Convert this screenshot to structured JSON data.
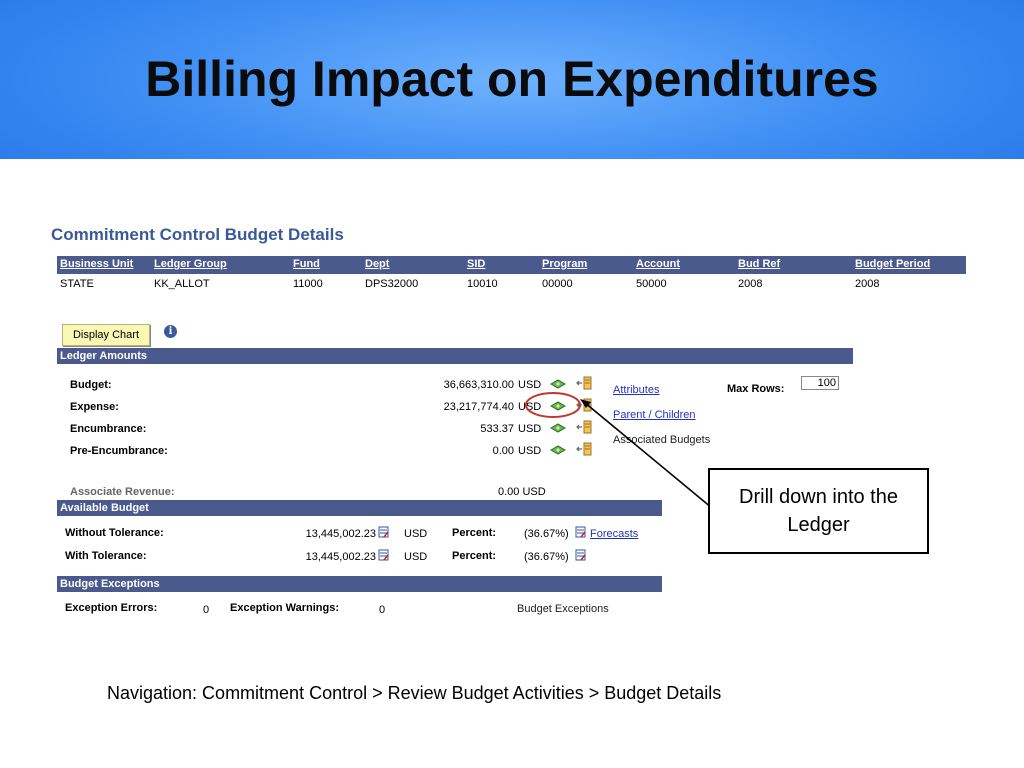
{
  "slide": {
    "title": "Billing Impact on Expenditures",
    "footer": "Navigation: Commitment Control > Review Budget Activities > Budget Details",
    "callout": "Drill down into the Ledger"
  },
  "colors": {
    "banner": "#3f8ff4",
    "section_bar": "#4a5a8c",
    "section_title": "#3b5998",
    "link": "#2233bb",
    "callout_ring": "#c0392b",
    "button_bg": "#fbf7b5"
  },
  "page": {
    "title": "Commitment Control Budget Details",
    "header_cols": [
      "Business Unit",
      "Ledger Group",
      "Fund",
      "Dept",
      "SID",
      "Program",
      "Account",
      "Bud Ref",
      "Budget Period"
    ],
    "header_vals": [
      "STATE",
      "KK_ALLOT",
      "11000",
      "DPS32000",
      "10010",
      "00000",
      "50000",
      "2008",
      "2008"
    ],
    "display_chart": "Display Chart",
    "info_icon": "i"
  },
  "ledger": {
    "title": "Ledger Amounts",
    "rows": [
      {
        "label": "Budget:",
        "value": "36,663,310.00",
        "currency": "USD"
      },
      {
        "label": "Expense:",
        "value": "23,217,774.40",
        "currency": "USD"
      },
      {
        "label": "Encumbrance:",
        "value": "533.37",
        "currency": "USD"
      },
      {
        "label": "Pre-Encumbrance:",
        "value": "0.00",
        "currency": "USD"
      }
    ],
    "assoc_rev_label": "Associate Revenue:",
    "assoc_rev_value": "0.00 USD",
    "attributes": "Attributes",
    "parent_children": "Parent / Children",
    "associated_budgets": "Associated Budgets",
    "max_rows_label": "Max Rows:",
    "max_rows_value": "100"
  },
  "available": {
    "title": "Available Budget",
    "rows": [
      {
        "label": "Without Tolerance:",
        "value": "13,445,002.23",
        "currency": "USD",
        "percent_label": "Percent:",
        "percent": "(36.67%)",
        "link": "Forecasts"
      },
      {
        "label": "With Tolerance:",
        "value": "13,445,002.23",
        "currency": "USD",
        "percent_label": "Percent:",
        "percent": "(36.67%)"
      }
    ]
  },
  "exceptions": {
    "title": "Budget Exceptions",
    "errors_label": "Exception Errors:",
    "errors_value": "0",
    "warnings_label": "Exception Warnings:",
    "warnings_value": "0",
    "link": "Budget Exceptions"
  }
}
